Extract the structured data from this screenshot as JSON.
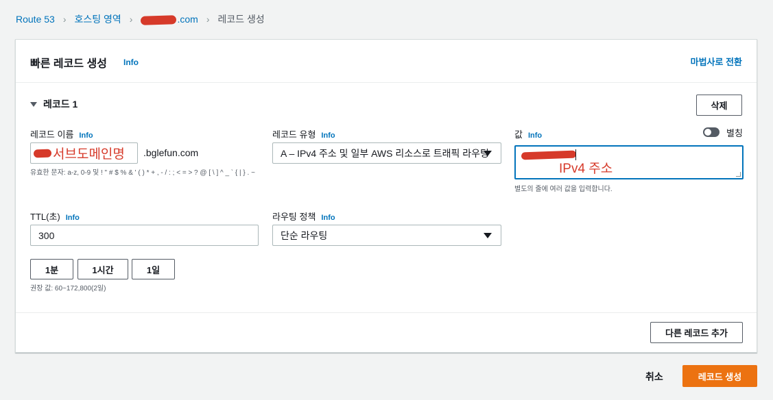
{
  "breadcrumb": {
    "items": [
      "Route 53",
      "호스팅 영역",
      ".com",
      "레코드 생성"
    ]
  },
  "panel": {
    "title": "빠른 레코드 생성",
    "info": "Info",
    "wizard_link": "마법사로 전환"
  },
  "record": {
    "section_label": "레코드 1",
    "delete_button": "삭제",
    "name": {
      "label": "레코드 이름",
      "info": "Info",
      "annotation": "서브도메인명",
      "suffix": ".bglefun.com",
      "hint": "유효한 문자: a-z, 0-9 및 ! \" # $ % & ' ( ) * + , - / : ; < = > ? @ [ \\ ] ^ _ ` { | } . ~"
    },
    "type": {
      "label": "레코드 유형",
      "info": "Info",
      "value": "A – IPv4 주소 및 일부 AWS 리소스로 트래픽 라우팅"
    },
    "value": {
      "label": "값",
      "info": "Info",
      "alias_label": "별칭",
      "annotation": "IPv4 주소",
      "hint": "별도의 줄에 여러 값을 입력합니다."
    },
    "ttl": {
      "label": "TTL(초)",
      "info": "Info",
      "value": "300",
      "presets": [
        "1분",
        "1시간",
        "1일"
      ],
      "hint": "권장 값: 60~172,800(2일)"
    },
    "routing": {
      "label": "라우팅 정책",
      "info": "Info",
      "value": "단순 라우팅"
    }
  },
  "add_record_button": "다른 레코드 추가",
  "footer": {
    "cancel": "취소",
    "create": "레코드 생성"
  },
  "colors": {
    "link": "#0073bb",
    "primary": "#ec7211",
    "annotation": "#d63a2a"
  }
}
